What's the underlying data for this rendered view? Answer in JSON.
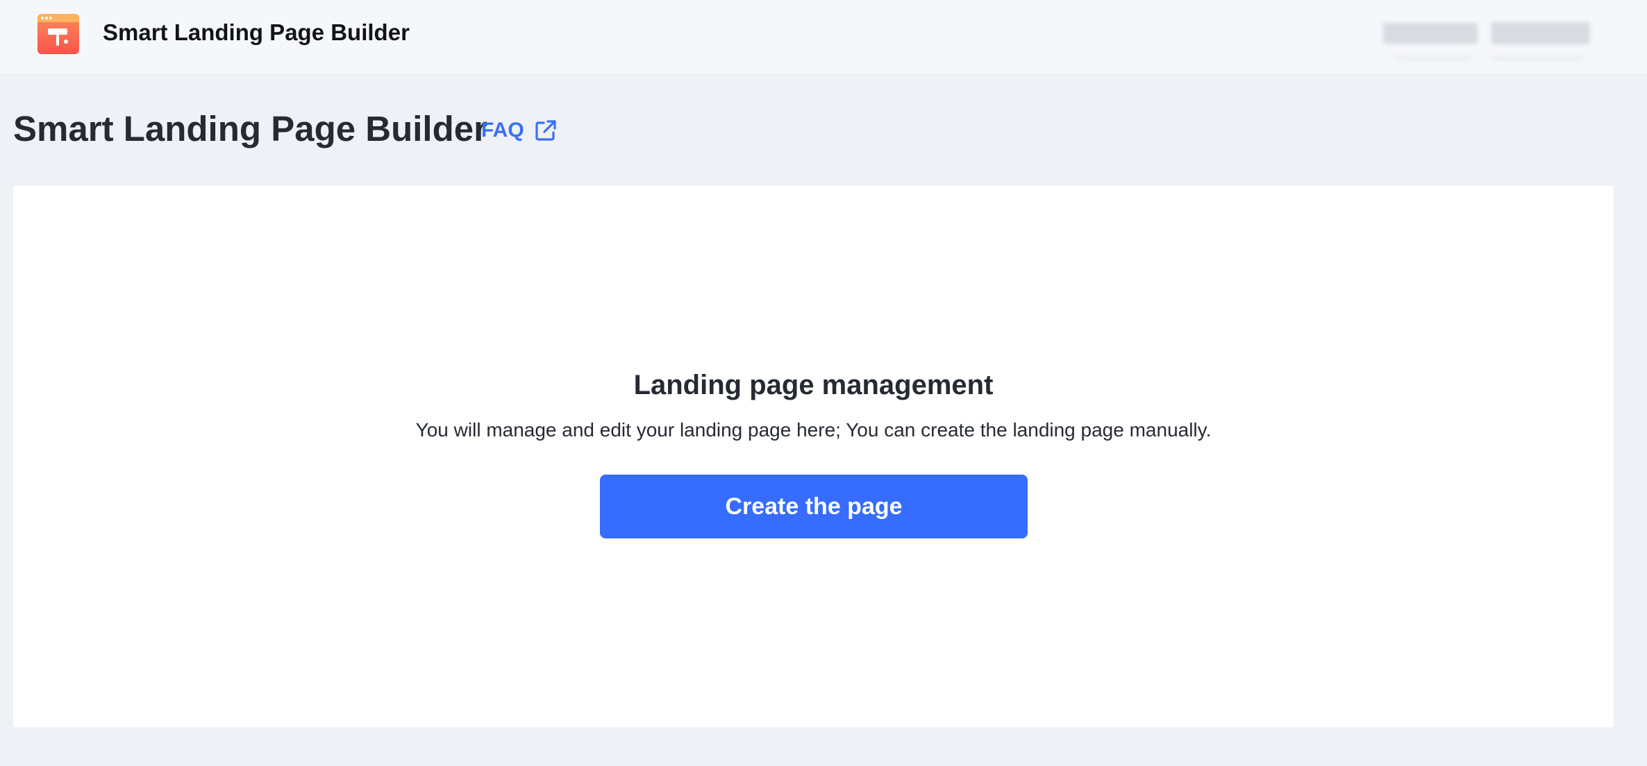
{
  "header": {
    "app_name": "Smart Landing Page Builder",
    "logo_icon": "paint-roller-window-icon"
  },
  "page": {
    "title": "Smart Landing Page Builder",
    "faq_label": "FAQ",
    "faq_icon": "external-link-icon"
  },
  "empty_state": {
    "title": "Landing page management",
    "description": "You will manage and edit your landing page here; You can create the landing page manually.",
    "button_label": "Create the page"
  },
  "colors": {
    "accent": "#366cff",
    "link": "#3a6ff7",
    "background": "#eef1f5",
    "topbar": "#f6f7fa",
    "card": "#ffffff",
    "text": "#262a33"
  }
}
